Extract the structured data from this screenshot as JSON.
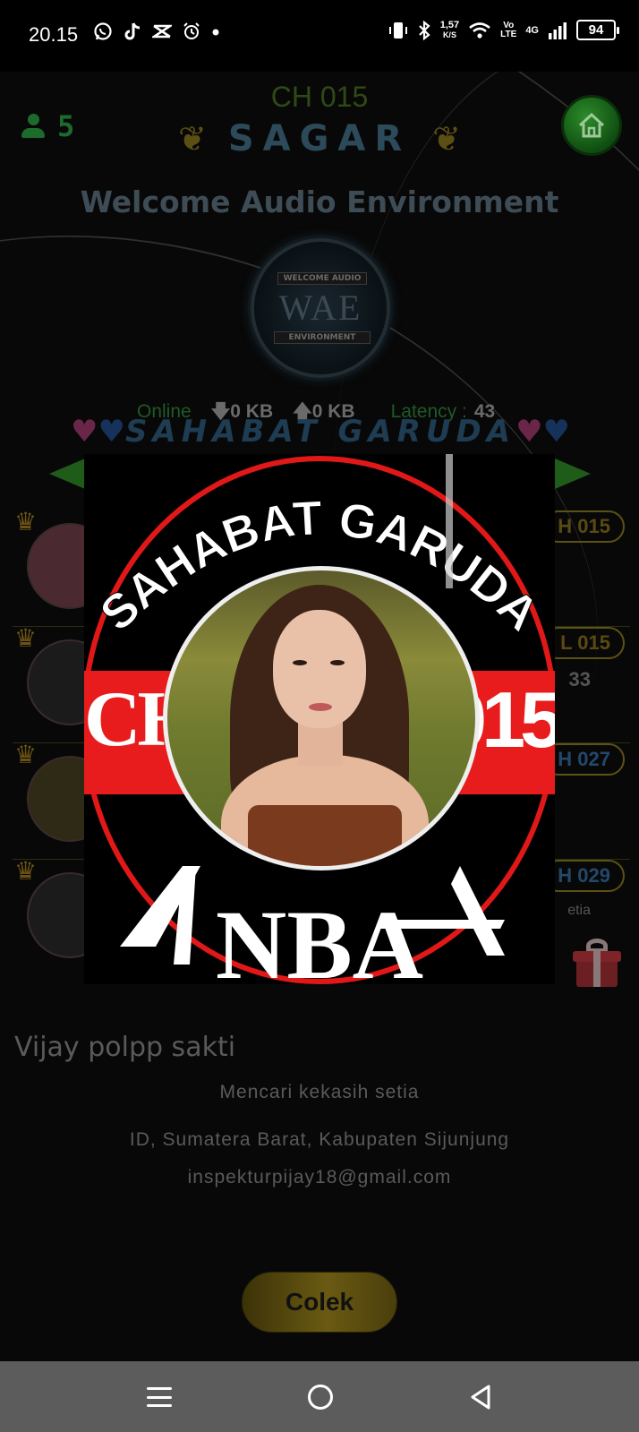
{
  "status_bar": {
    "time": "20.15",
    "net_speed_value": "1,57",
    "net_speed_unit": "K/S",
    "volte_top": "Vo",
    "volte_bottom": "LTE",
    "network": "4G",
    "battery": "94",
    "icons": [
      "whatsapp-icon",
      "tiktok-icon",
      "capcut-icon",
      "alarm-icon",
      "dot-icon",
      "vibrate-icon",
      "bluetooth-icon",
      "wifi-icon",
      "signal-icon",
      "battery-icon"
    ]
  },
  "header": {
    "user_count": "5",
    "channel": "CH 015",
    "room_name": "SAGAR",
    "welcome": "Welcome Audio Environment",
    "logo_top": "WELCOME AUDIO",
    "logo_mid": "WAE",
    "logo_bottom": "ENVIRONMENT"
  },
  "stats": {
    "online_label": "Online",
    "download": "0 KB",
    "upload": "0 KB",
    "latency_label": "Latency :",
    "latency_value": "43"
  },
  "banner": "SAHABAT GARUDA",
  "members": [
    {
      "channel": "H 015",
      "extra": "",
      "badge_color": "#5a4a12"
    },
    {
      "channel": "L 015",
      "extra": "33",
      "badge_color": "#5a4a12"
    },
    {
      "channel": "H 027",
      "extra": "",
      "badge_color": "#24486b"
    },
    {
      "channel": "H 029",
      "extra": "etia",
      "badge_color": "#24486b"
    }
  ],
  "popup": {
    "arc_text": "SAHABAT GARUDA",
    "left_text": "CH",
    "right_text": "015",
    "bottom_text": "NBA"
  },
  "profile": {
    "name": "Vijay polpp sakti",
    "status": "Mencari kekasih setia",
    "location": "ID, Sumatera Barat, Kabupaten Sijunjung",
    "email": "inspekturpijay18@gmail.com"
  },
  "actions": {
    "colek": "Colek"
  },
  "colors": {
    "accent_green": "#1f5c19",
    "popup_red": "#e81c1c",
    "gold": "#6a5a12"
  }
}
